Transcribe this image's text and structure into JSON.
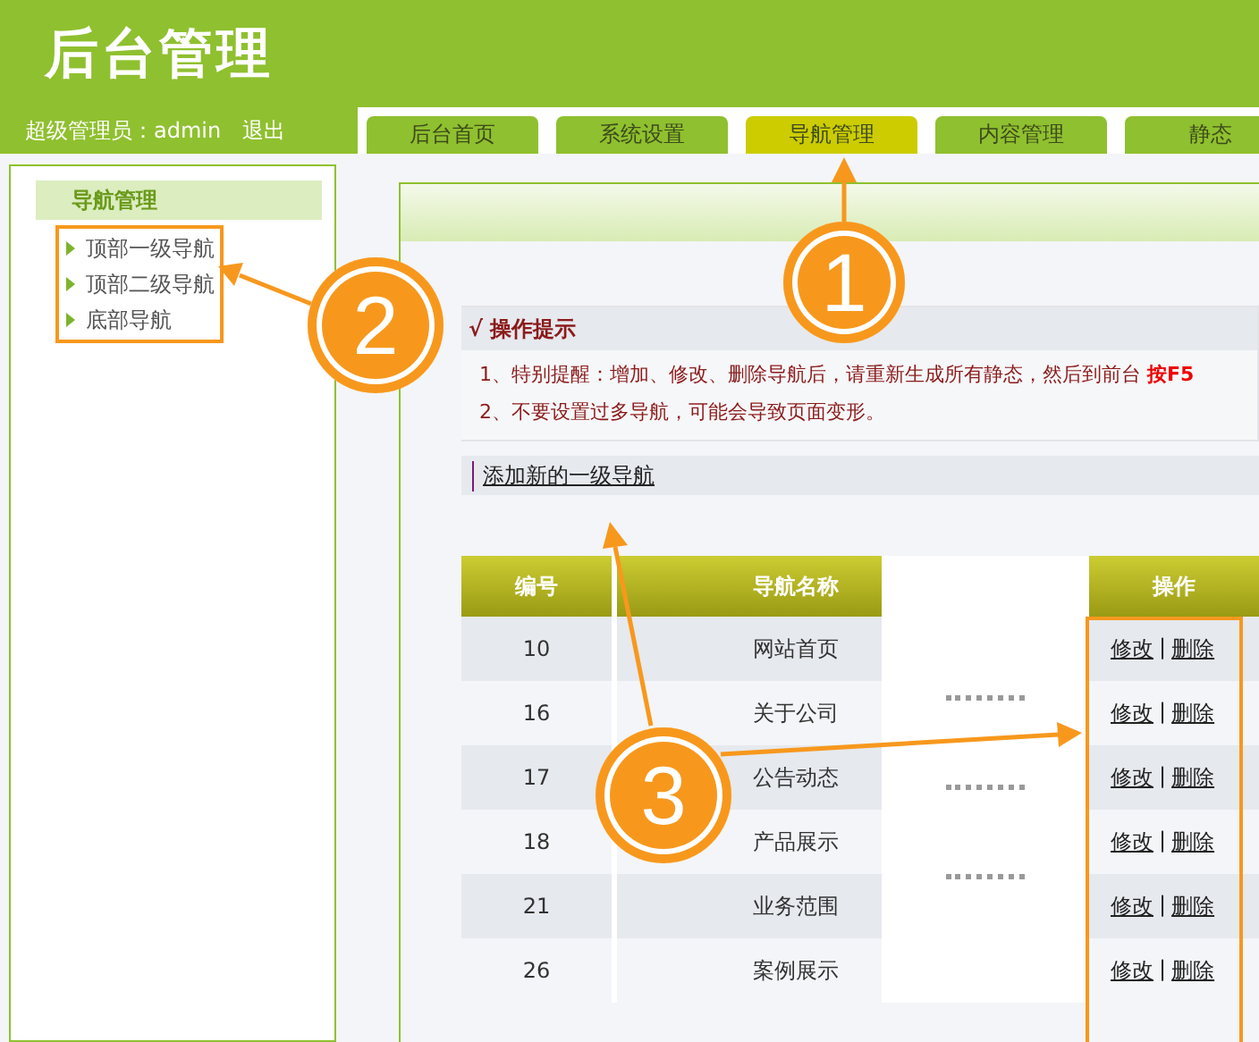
{
  "header": {
    "title": "后台管理",
    "user_label": "超级管理员：admin",
    "logout": "退出"
  },
  "tabs": [
    {
      "label": "后台首页",
      "selected": false
    },
    {
      "label": "系统设置",
      "selected": false
    },
    {
      "label": "导航管理",
      "selected": true
    },
    {
      "label": "内容管理",
      "selected": false
    },
    {
      "label": "静态",
      "selected": false
    }
  ],
  "sidebar": {
    "title": "导航管理",
    "items": [
      "顶部一级导航",
      "顶部二级导航",
      "底部导航"
    ]
  },
  "tips": {
    "title": "√ 操作提示",
    "lines": [
      "1、特别提醒：增加、修改、删除导航后，请重新生成所有静态，然后到前台 **按F5**",
      "2、不要设置过多导航，可能会导致页面变形。"
    ]
  },
  "add_link": "添加新的一级导航",
  "table": {
    "columns": [
      "编号",
      "导航名称",
      "操作"
    ],
    "rows": [
      {
        "id": "10",
        "name": "网站首页",
        "actions": [
          "修改",
          "删除"
        ],
        "separator": "|"
      },
      {
        "id": "16",
        "name": "关于公司",
        "actions": [
          "修改",
          "删除"
        ],
        "separator": "|"
      },
      {
        "id": "17",
        "name": "公告动态",
        "actions": [
          "修改",
          "删除"
        ],
        "separator": "|"
      },
      {
        "id": "18",
        "name": "产品展示",
        "actions": [
          "修改",
          "删除"
        ],
        "separator": "|"
      },
      {
        "id": "21",
        "name": "业务范围",
        "actions": [
          "修改",
          "删除"
        ],
        "separator": "|"
      },
      {
        "id": "26",
        "name": "案例展示",
        "actions": [
          "修改",
          "删除"
        ],
        "separator": "|"
      }
    ]
  },
  "callouts": [
    "1",
    "2",
    "3"
  ]
}
